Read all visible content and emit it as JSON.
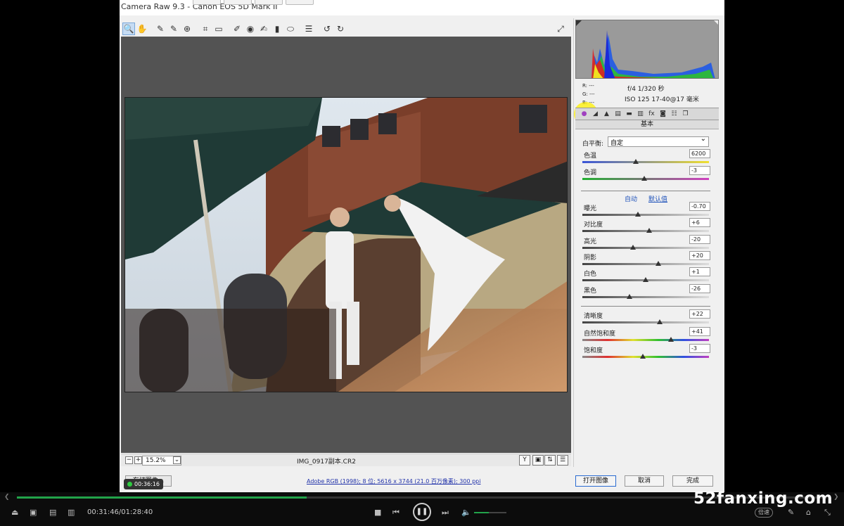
{
  "window": {
    "title": "Camera Raw 9.3 -  Canon EOS 5D Mark II"
  },
  "toolbar": {
    "tools": [
      {
        "name": "zoom-tool",
        "glyph": "🔍"
      },
      {
        "name": "hand-tool",
        "glyph": "✋"
      },
      {
        "name": "white-balance-tool",
        "glyph": "✎"
      },
      {
        "name": "color-sampler-tool",
        "glyph": "✎"
      },
      {
        "name": "targeted-adjustment-tool",
        "glyph": "⊕"
      },
      {
        "name": "crop-tool",
        "glyph": "⌗"
      },
      {
        "name": "straighten-tool",
        "glyph": "▭"
      },
      {
        "name": "spot-removal-tool",
        "glyph": "✐"
      },
      {
        "name": "red-eye-tool",
        "glyph": "◉"
      },
      {
        "name": "adjustment-brush-tool",
        "glyph": "✍"
      },
      {
        "name": "graduated-filter-tool",
        "glyph": "▮"
      },
      {
        "name": "radial-filter-tool",
        "glyph": "⬭"
      },
      {
        "name": "preferences-tool",
        "glyph": "☰"
      },
      {
        "name": "rotate-ccw-tool",
        "glyph": "↺"
      },
      {
        "name": "rotate-cw-tool",
        "glyph": "↻"
      }
    ]
  },
  "status": {
    "zoom": "15.2%",
    "filename": "IMG_0917副本.CR2"
  },
  "info": {
    "r": "R:  ---",
    "g": "G:  ---",
    "b": "B:  ---",
    "aperture_shutter": "f/4   1/320 秒",
    "iso_lens": "ISO 125   17-40@17 毫米"
  },
  "panel": {
    "section": "基本",
    "wb_label": "白平衡:",
    "wb_value": "自定",
    "auto": "自动",
    "default": "默认值",
    "sliders": [
      {
        "label": "色温",
        "value": "6200",
        "pos": 0.42,
        "track": "temp"
      },
      {
        "label": "色调",
        "value": "-3",
        "pos": 0.49,
        "track": "tint"
      },
      {
        "label": "曝光",
        "value": "-0.70",
        "pos": 0.44,
        "track": "gray"
      },
      {
        "label": "对比度",
        "value": "+6",
        "pos": 0.53,
        "track": "gray"
      },
      {
        "label": "高光",
        "value": "-20",
        "pos": 0.4,
        "track": "gray"
      },
      {
        "label": "阴影",
        "value": "+20",
        "pos": 0.6,
        "track": "gray"
      },
      {
        "label": "白色",
        "value": "+1",
        "pos": 0.5,
        "track": "gray"
      },
      {
        "label": "黑色",
        "value": "-26",
        "pos": 0.37,
        "track": "gray"
      },
      {
        "label": "清晰度",
        "value": "+22",
        "pos": 0.61,
        "track": "gray"
      },
      {
        "label": "自然饱和度",
        "value": "+41",
        "pos": 0.7,
        "track": "sat"
      },
      {
        "label": "饱和度",
        "value": "-3",
        "pos": 0.48,
        "track": "sat"
      }
    ]
  },
  "bottom": {
    "save": "存储图像...",
    "workflow": "Adobe RGB (1998); 8 位; 5616 x 3744 (21.0 百万像素); 300 ppi",
    "open": "打开图像",
    "cancel": "取消",
    "done": "完成"
  },
  "player": {
    "rec_time": "00:36:16",
    "time": "00:31:46/01:28:40",
    "progress": 0.358,
    "volume": 0.45,
    "speed": "倍速",
    "watermark": "52fanxing.com"
  }
}
